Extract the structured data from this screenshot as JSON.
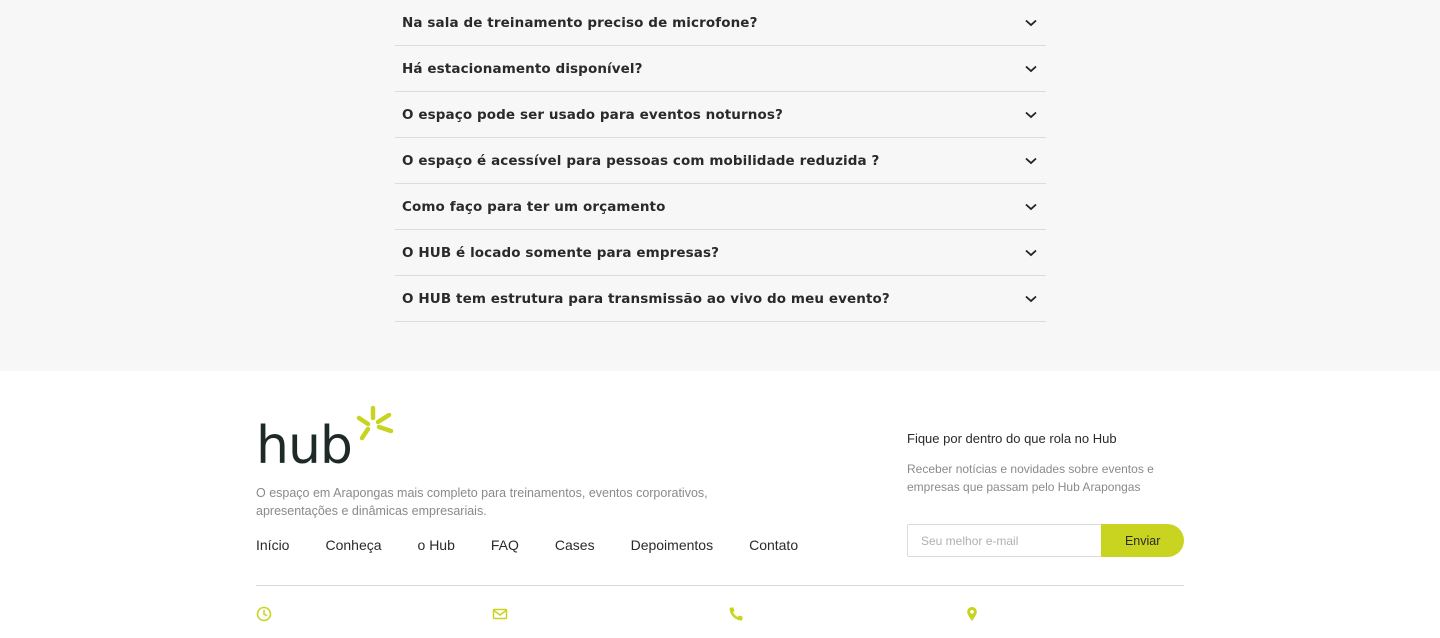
{
  "faq": {
    "items": [
      {
        "question": "Na sala de treinamento preciso de microfone?"
      },
      {
        "question": "Há estacionamento disponível?"
      },
      {
        "question": "O espaço pode ser usado para eventos noturnos?"
      },
      {
        "question": "O espaço é acessível para pessoas com mobilidade reduzida ?"
      },
      {
        "question": "Como faço para ter um orçamento"
      },
      {
        "question": "O HUB é locado somente para empresas?"
      },
      {
        "question": "O HUB tem estrutura para transmissão ao vivo do meu evento?"
      }
    ]
  },
  "footer": {
    "logo_text": "hub",
    "tagline": "O espaço em Arapongas mais completo para treinamentos, eventos corporativos, apresentações e dinâmicas empresariais.",
    "nav": [
      "Início",
      "Conheça",
      "o Hub",
      "FAQ",
      "Cases",
      "Depoimentos",
      "Contato"
    ],
    "newsletter": {
      "title": "Fique por dentro do que rola no Hub",
      "description": "Receber notícias e novidades sobre eventos e empresas que passam pelo Hub Arapongas",
      "placeholder": "Seu melhor e-mail",
      "button": "Enviar"
    },
    "contact_icons": [
      "clock-icon",
      "envelope-icon",
      "phone-icon",
      "map-pin-icon"
    ]
  },
  "colors": {
    "accent": "#c9d421",
    "logo_dark": "#1e2a28",
    "text": "#2a2a2a",
    "muted": "#8a8a8a",
    "faq_bg": "#f7f7f7"
  }
}
